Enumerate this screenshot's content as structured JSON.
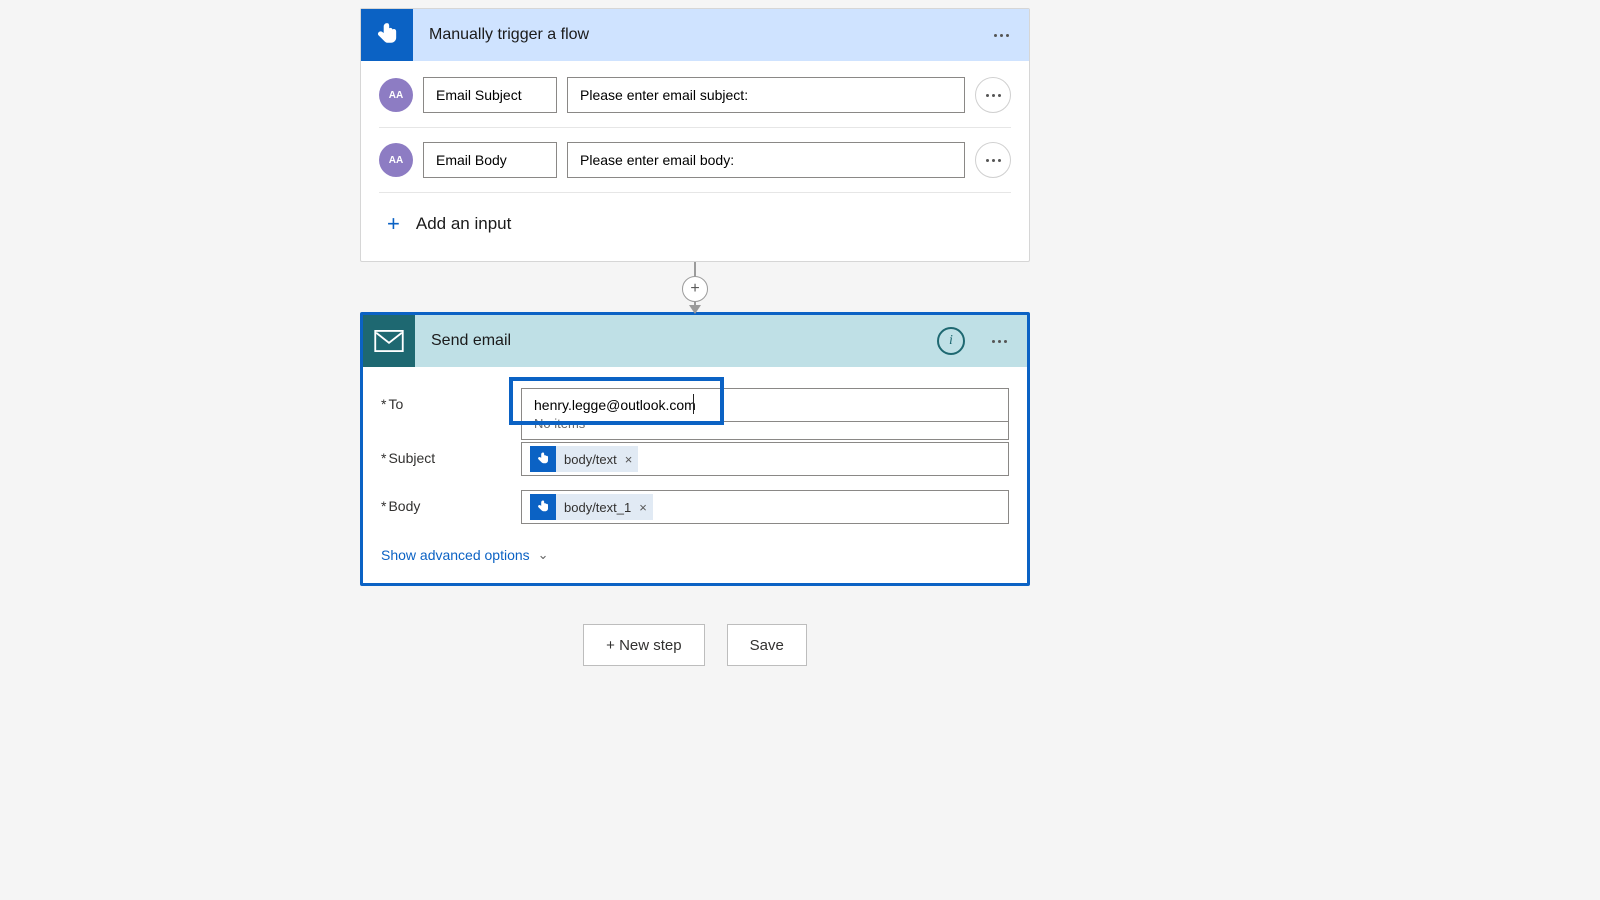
{
  "trigger": {
    "title": "Manually trigger a flow",
    "avatar_text": "AA",
    "inputs": [
      {
        "name": "Email Subject",
        "prompt": "Please enter email subject:"
      },
      {
        "name": "Email Body",
        "prompt": "Please enter email body:"
      }
    ],
    "add_input_label": "Add an input"
  },
  "action": {
    "title": "Send email",
    "fields": {
      "to_label": "To",
      "subject_label": "Subject",
      "body_label": "Body"
    },
    "to_value": "henry.legge@outlook.com",
    "dropdown_no_items": "No items",
    "subject_token": "body/text",
    "body_token": "body/text_1",
    "advanced_label": "Show advanced options"
  },
  "footer": {
    "new_step": "+ New step",
    "save": "Save"
  },
  "symbols": {
    "asterisk": "*",
    "plus": "+",
    "x": "×",
    "chevron": "⌄",
    "info": "i"
  }
}
